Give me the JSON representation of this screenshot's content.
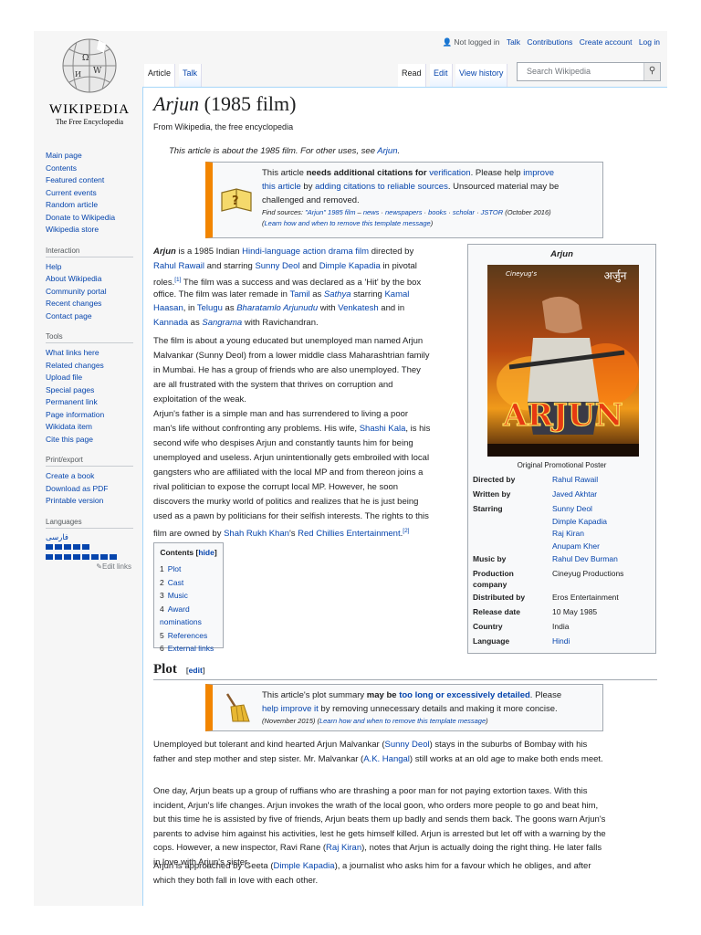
{
  "logo": {
    "wordmark": "Wikipedia",
    "tagline": "The Free Encyclopedia"
  },
  "personal": {
    "not_logged_in": "Not logged in",
    "talk": "Talk",
    "contributions": "Contributions",
    "create_account": "Create account",
    "login": "Log in"
  },
  "tabs": {
    "article": "Article",
    "talk": "Talk",
    "read": "Read",
    "edit": "Edit",
    "history": "View history"
  },
  "search": {
    "placeholder": "Search Wikipedia"
  },
  "sidebar": {
    "main": [
      "Main page",
      "Contents",
      "Featured content",
      "Current events",
      "Random article",
      "Donate to Wikipedia",
      "Wikipedia store"
    ],
    "interaction_title": "Interaction",
    "interaction": [
      "Help",
      "About Wikipedia",
      "Community portal",
      "Recent changes",
      "Contact page"
    ],
    "tools_title": "Tools",
    "tools": [
      "What links here",
      "Related changes",
      "Upload file",
      "Special pages",
      "Permanent link",
      "Page information",
      "Wikidata item",
      "Cite this page"
    ],
    "print_title": "Print/export",
    "print": [
      "Create a book",
      "Download as PDF",
      "Printable version"
    ],
    "languages_title": "Languages",
    "language_farsi": "فارسی",
    "edit_links": "Edit links"
  },
  "page": {
    "title_italic": "Arjun",
    "title_rest": " (1985 film)",
    "subtitle": "From Wikipedia, the free encyclopedia",
    "hatnote_pre": "This article is about the 1985 film. For other uses, see ",
    "hatnote_link": "Arjun",
    "hatnote_post": "."
  },
  "citation_box": {
    "l1a": "This article ",
    "l1b": "needs additional citations for ",
    "l1c": "verification",
    ". ": "",
    "l1d": ". Please help ",
    "l1e": "improve",
    "l2a": "this article",
    "l2b": " by ",
    "l2c": "adding citations to reliable sources",
    "l2d": ". Unsourced material may be",
    "l3": "challenged and removed.",
    "l4a": "Find sources: ",
    "l4b": "\"Arjun\" 1985 film",
    "l4c": " – ",
    "l4d": "news",
    "l4e": " · ",
    "l4f": "newspapers",
    "l4g": " · ",
    "l4h": "books",
    "l4i": " · ",
    "l4j": "scholar",
    "l4k": " · ",
    "l4l": "JSTOR",
    "l4m": " (October 2016)",
    "l5a": "(",
    "l5b": "Learn how and when to remove this template message",
    "l5c": ")"
  },
  "intro": {
    "p1": [
      [
        "Arjun",
        "b"
      ],
      [
        " is a 1985 Indian ",
        ""
      ],
      [
        "Hindi-language",
        "a"
      ],
      [
        " ",
        ""
      ],
      [
        "action drama film",
        "a"
      ],
      [
        " directed by",
        ""
      ]
    ],
    "p1l2": [
      [
        "Rahul Rawail",
        "a"
      ],
      [
        " and starring ",
        ""
      ],
      [
        "Sunny Deol",
        "a"
      ],
      [
        " and ",
        ""
      ],
      [
        "Dimple Kapadia",
        "a"
      ],
      [
        " in pivotal",
        ""
      ]
    ],
    "p1l3": [
      [
        "roles.",
        ""
      ],
      [
        "[1]",
        "s"
      ],
      [
        " The film was a success and was declared as a 'Hit' by the box",
        ""
      ]
    ],
    "p1l4": [
      [
        "office. The film was later remade in ",
        ""
      ],
      [
        "Tamil",
        "a"
      ],
      [
        " as ",
        ""
      ],
      [
        "Sathya",
        "ai"
      ],
      [
        " starring ",
        ""
      ],
      [
        "Kamal",
        "a"
      ]
    ],
    "p1l5": [
      [
        "Haasan",
        "a"
      ],
      [
        ", in ",
        ""
      ],
      [
        "Telugu",
        "a"
      ],
      [
        " as ",
        ""
      ],
      [
        "Bharatamlo Arjunudu",
        "ai"
      ],
      [
        " with ",
        ""
      ],
      [
        "Venkatesh",
        "a"
      ],
      [
        " and in",
        ""
      ]
    ],
    "p1l6": [
      [
        "Kannada",
        "a"
      ],
      [
        " as ",
        ""
      ],
      [
        "Sangrama",
        "ai"
      ],
      [
        " with Ravichandran.",
        ""
      ]
    ],
    "p2": [
      "The film is about a young educated but unemployed man named Arjun",
      "Malvankar (Sunny Deol) from a lower middle class Maharashtrian family",
      "in Mumbai. He has a group of friends who are also unemployed. They",
      "are all frustrated with the system that thrives on corruption and",
      "exploitation of the weak."
    ],
    "p3": [
      [
        [
          "Arjun's father is a simple man and has surrendered to living a poor",
          ""
        ]
      ],
      [
        [
          "man's life without confronting any problems. His wife, ",
          ""
        ],
        [
          "Shashi Kala",
          "a"
        ],
        [
          ", is his",
          ""
        ]
      ],
      [
        [
          "second wife who despises Arjun and constantly taunts him for being",
          ""
        ]
      ],
      [
        [
          "unemployed and useless. Arjun unintentionally gets embroiled with local",
          ""
        ]
      ],
      [
        [
          "gangsters who are affiliated with the local MP and from thereon joins a",
          ""
        ]
      ],
      [
        [
          "rival politician to expose the corrupt local MP. However, he soon",
          ""
        ]
      ],
      [
        [
          "discovers the murky world of politics and realizes that he is just being",
          ""
        ]
      ],
      [
        [
          "used as a pawn by politicians for their selfish interests. The rights to this",
          ""
        ]
      ],
      [
        [
          "film are owned by ",
          ""
        ],
        [
          "Shah Rukh Khan",
          "a"
        ],
        [
          "'s ",
          ""
        ],
        [
          "Red Chillies Entertainment",
          "a"
        ],
        [
          ".",
          ""
        ],
        [
          "[2]",
          "s"
        ]
      ]
    ]
  },
  "infobox": {
    "title": "Arjun",
    "caption": "Original Promotional Poster",
    "poster_title": "ARJUN",
    "poster_hindi": "अर्जुन",
    "poster_brand": "Cineyug's",
    "rows": [
      {
        "label": "Directed by",
        "values": [
          "Rahul Rawail"
        ],
        "link": true
      },
      {
        "label": "Written by",
        "values": [
          "Javed Akhtar"
        ],
        "link": true
      },
      {
        "label": "Starring",
        "values": [
          "Sunny Deol",
          "Dimple Kapadia",
          "Raj Kiran",
          "Anupam Kher"
        ],
        "link": true
      },
      {
        "label": "Music by",
        "values": [
          "Rahul Dev Burman"
        ],
        "link": true
      },
      {
        "label": "Production company",
        "values": [
          "Cineyug Productions"
        ],
        "link": false
      },
      {
        "label": "Distributed by",
        "values": [
          "Eros Entertainment"
        ],
        "link": false
      },
      {
        "label": "Release date",
        "values": [
          "10 May 1985"
        ],
        "link": false
      },
      {
        "label": "Country",
        "values": [
          "India"
        ],
        "link": false
      },
      {
        "label": "Language",
        "values": [
          "Hindi"
        ],
        "link": true
      }
    ]
  },
  "toc": {
    "title": "Contents",
    "hide": "hide",
    "items": [
      {
        "num": "1",
        "label": "Plot"
      },
      {
        "num": "2",
        "label": "Cast"
      },
      {
        "num": "3",
        "label": "Music"
      },
      {
        "num": "4",
        "label": "Award nominations"
      },
      {
        "num": "5",
        "label": "References"
      },
      {
        "num": "6",
        "label": "External links"
      }
    ]
  },
  "plot": {
    "heading": "Plot",
    "edit": "edit",
    "box": {
      "l1a": "This article's plot summary ",
      "l1b": "may be ",
      "l1c": "too long or excessively detailed",
      "l1d": ". Please",
      "l2a": "help improve it",
      "l2b": " by removing unnecessary details and making it more concise.",
      "l3a": "(November 2015) (",
      "l3b": "Learn how and when to remove this template message",
      "l3c": ")"
    },
    "p1": [
      [
        [
          "Unemployed but tolerant and kind hearted Arjun Malvankar (",
          ""
        ],
        [
          "Sunny Deol",
          "a"
        ],
        [
          ") stays in the suburbs of Bombay with his",
          ""
        ]
      ],
      [
        [
          "father and step mother and step sister. Mr. Malvankar (",
          ""
        ],
        [
          "A.K. Hangal",
          "a"
        ],
        [
          ") still works at an old age to make both ends meet.",
          ""
        ]
      ]
    ],
    "p2": [
      [
        [
          "One day, Arjun beats up a group of ruffians who are thrashing a poor man for not paying extortion taxes. With this",
          ""
        ]
      ],
      [
        [
          "incident, Arjun's life changes. Arjun invokes the wrath of the local goon, who orders more people to go and beat him,",
          ""
        ]
      ],
      [
        [
          "but this time he is assisted by five of friends, Arjun beats them up badly and sends them back. The goons warn Arjun's",
          ""
        ]
      ],
      [
        [
          "parents to advise him against his activities, lest he gets himself killed. Arjun is arrested but let off with a warning by the",
          ""
        ]
      ],
      [
        [
          "cops. However, a new inspector, Ravi Rane (",
          ""
        ],
        [
          "Raj Kiran",
          "a"
        ],
        [
          "), notes that Arjun is actually doing the right thing. He later falls",
          ""
        ]
      ],
      [
        [
          "in love with Arjun's sister.",
          ""
        ]
      ]
    ],
    "p3": [
      [
        [
          "Arjun is approached by Geeta (",
          ""
        ],
        [
          "Dimple Kapadia",
          "a"
        ],
        [
          "), a journalist who asks him for a favour which he obliges, and after",
          ""
        ]
      ],
      [
        [
          "which they both fall in love with each other.",
          ""
        ]
      ]
    ]
  }
}
